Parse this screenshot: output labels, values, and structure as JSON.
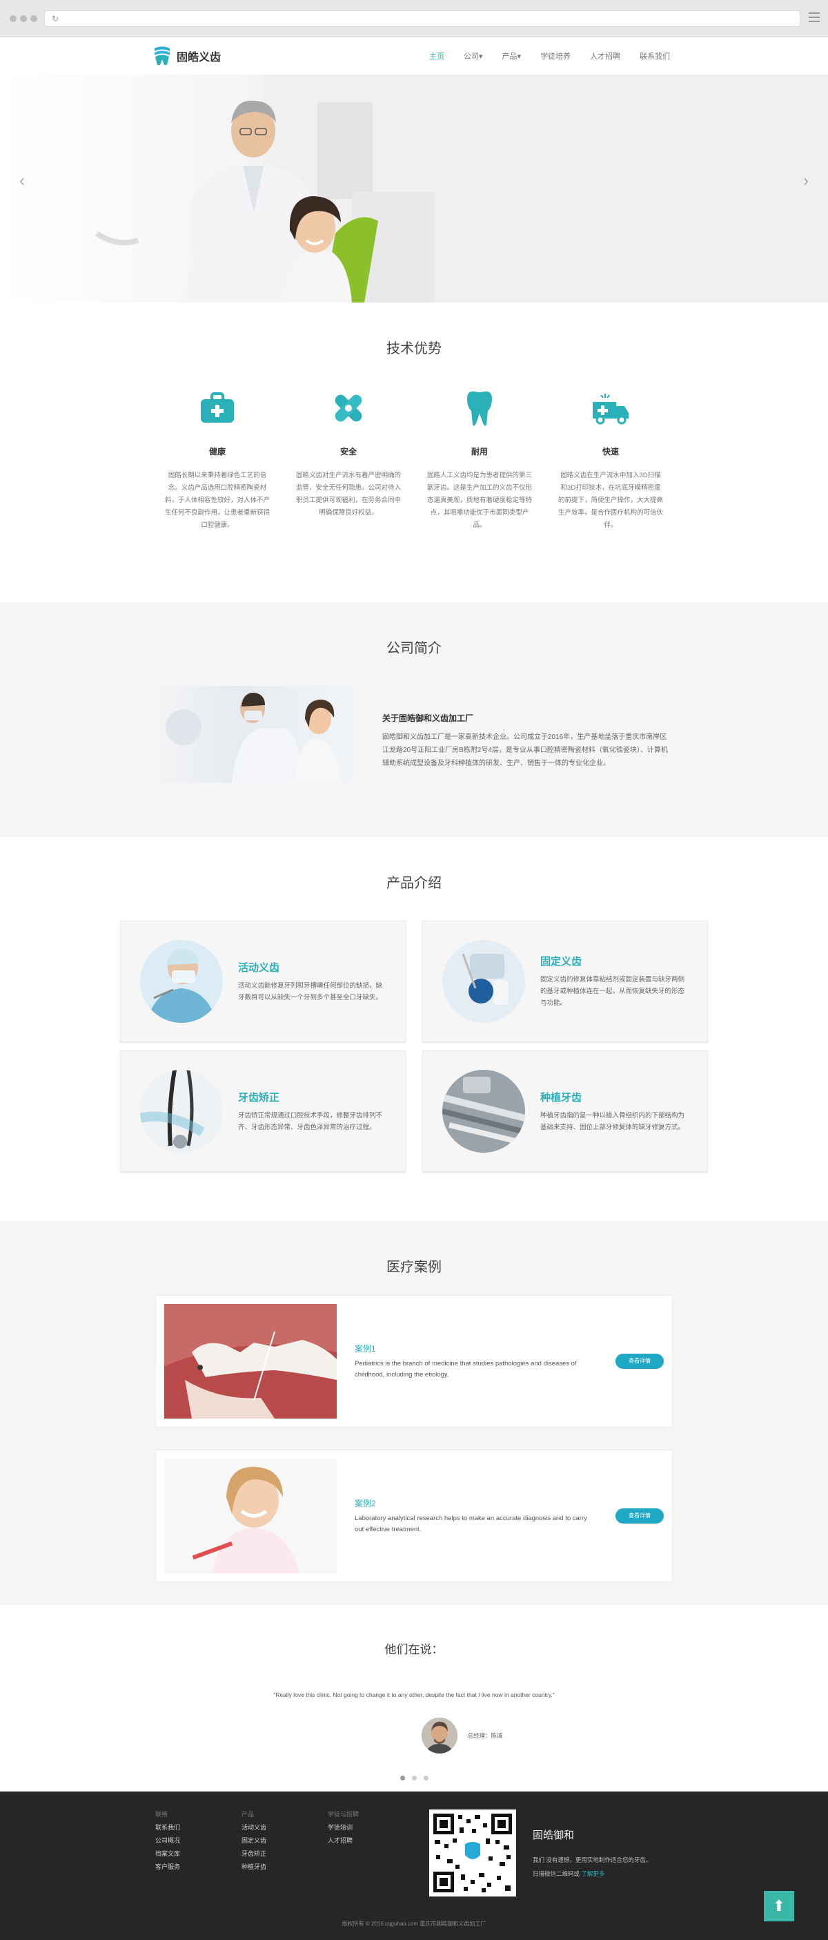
{
  "nav": {
    "logo_text": "固皓义齿",
    "menu": [
      "主页",
      "公司▾",
      "产品▾",
      "学徒培养",
      "人才招聘",
      "联系我们"
    ]
  },
  "advantages": {
    "title": "技术优势",
    "items": [
      {
        "icon": "medkit-icon",
        "name": "健康",
        "desc": "固皓长期以来秉持着绿色工艺的信念。义齿产品选用口腔精密陶瓷材料，于人体相容性较好，对人体不产生任何不良副作用，让患者重新获得口腔健康。"
      },
      {
        "icon": "bandage-icon",
        "name": "安全",
        "desc": "固皓义齿对生产流水有着严密明确的监管，安全无任何隐患。公司对待入职员工提供可观福利，在劳务合同中明确保障良好权益。"
      },
      {
        "icon": "tooth-icon",
        "name": "耐用",
        "desc": "固皓人工义齿均是为患者提供的第三副牙齿。这是生产加工的义齿不仅形态逼真美观，质地有着硬度稳定等特点，其咀嚼功能优于市面同类型产品。"
      },
      {
        "icon": "ambulance-icon",
        "name": "快速",
        "desc": "固皓义齿在生产流水中加入3D扫描和3D打印技术，在坑底牙模精密度的前提下，简便生产操作，大大提高生产效率，是合作医疗机构的可信伙伴。"
      }
    ]
  },
  "about": {
    "title": "公司简介",
    "heading": "关于固皓御和义齿加工厂",
    "text": "固皓御和义齿加工厂是一家高新技术企业。公司成立于2016年，生产基地坐落于重庆市南岸区江龙路20号正阳工业厂房B栋附2号4层，是专业从事口腔精密陶瓷材料（氧化锆瓷块）、计算机辅助系统成型设备及牙科种植体的研发、生产、销售于一体的专业化企业。"
  },
  "products": {
    "title": "产品介绍",
    "items": [
      {
        "name": "活动义齿",
        "desc": "活动义齿能修复牙列和牙槽嵴任何部位的缺损，缺牙数目可以从缺失一个牙到多个甚至全口牙缺失。"
      },
      {
        "name": "固定义齿",
        "desc": "固定义齿的修复体靠粘结剂或固定装置与缺牙两侧的基牙或种植体连在一起，从而恢复缺失牙的形态与功能。"
      },
      {
        "name": "牙齿矫正",
        "desc": "牙齿矫正常规通过口腔技术手段，修整牙齿排列不齐、牙齿形态异常、牙齿色泽异常的治疗过程。"
      },
      {
        "name": "种植牙齿",
        "desc": "种植牙齿指的是一种以植入骨组织内的下部结构为基础来支持、固位上部牙修复体的缺牙修复方式。"
      }
    ]
  },
  "cases": {
    "title": "医疗案例",
    "items": [
      {
        "name": "案例1",
        "desc": "Pediatrics is the branch of medicine that studies pathologies and diseases of childhood, including the etiology.",
        "button": "查看详情"
      },
      {
        "name": "案例2",
        "desc": "Laboratory analytical research helps to make an accurate diagnosis and to carry out effective treatment.",
        "button": "查看详情"
      }
    ]
  },
  "testimonials": {
    "title": "他们在说：",
    "quote": "\"Really love this clinic. Not going to change it to any other, despite the fact that I live now in another country.\"",
    "author": "总经理：陈诚"
  },
  "footer": {
    "cols": [
      {
        "head": "联络",
        "links": [
          "联系我们",
          "公司概况",
          "档案文库",
          "客户服务"
        ]
      },
      {
        "head": "产品",
        "links": [
          "活动义齿",
          "固定义齿",
          "牙齿矫正",
          "种植牙齿"
        ]
      },
      {
        "head": "学徒与招聘",
        "links": [
          "学徒培训",
          "人才招聘"
        ]
      }
    ],
    "brand": "固皓御和",
    "slogan": "我们 没有遗憾，更用实地制作适合您的牙齿。",
    "scan_text": "扫描微信二维码或",
    "scan_link": "了解更多",
    "copyright": "版权所有 © 2016 cqguhao.com 重庆市固皓御和义齿加工厂",
    "top_icon": "arrow-up-icon"
  }
}
